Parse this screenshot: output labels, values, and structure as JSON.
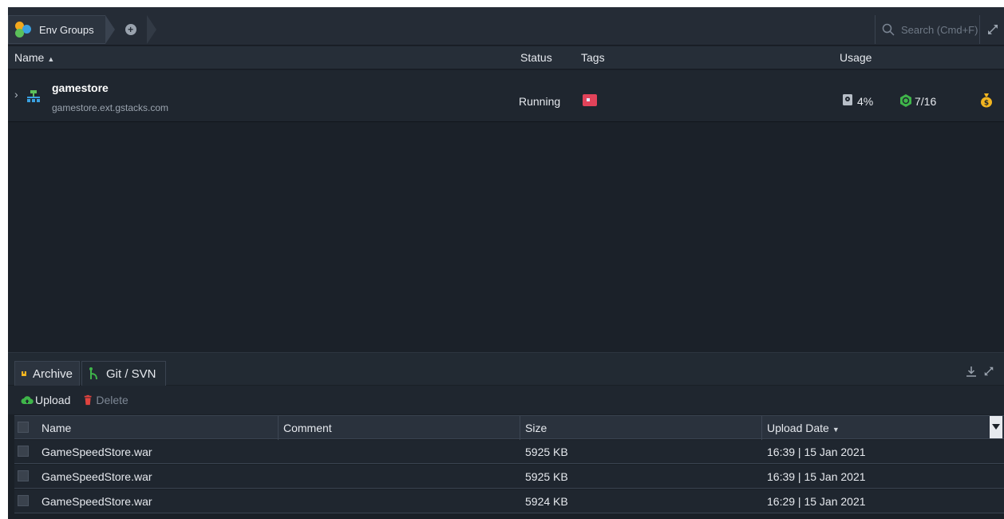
{
  "toolbar": {
    "breadcrumb_label": "Env Groups",
    "search_placeholder": "Search (Cmd+F)"
  },
  "env_header": {
    "name": "Name",
    "status": "Status",
    "tags": "Tags",
    "usage": "Usage"
  },
  "environment": {
    "name": "gamestore",
    "domain": "gamestore.ext.gstacks.com",
    "status": "Running",
    "disk_usage": "4%",
    "cloudlets": "7/16"
  },
  "panel": {
    "tabs": [
      {
        "label": "Archive"
      },
      {
        "label": "Git / SVN"
      }
    ],
    "actions": {
      "upload": "Upload",
      "delete": "Delete"
    },
    "columns": {
      "name": "Name",
      "comment": "Comment",
      "size": "Size",
      "upload_date": "Upload Date"
    },
    "files": [
      {
        "name": "GameSpeedStore.war",
        "comment": "",
        "size": "5925 KB",
        "date": "16:39 | 15 Jan 2021"
      },
      {
        "name": "GameSpeedStore.war",
        "comment": "",
        "size": "5925 KB",
        "date": "16:39 | 15 Jan 2021"
      },
      {
        "name": "GameSpeedStore.war",
        "comment": "",
        "size": "5924 KB",
        "date": "16:29 | 15 Jan 2021"
      }
    ]
  },
  "colors": {
    "background": "#1b2129",
    "accent_green": "#3fb54a",
    "delete_red": "#e0433f",
    "tag_red": "#e2435a",
    "money_gold": "#f2b520"
  },
  "icons": [
    "env-groups-icon",
    "plus-circle-icon",
    "search-icon",
    "expand-icon",
    "chevron-right-icon",
    "environment-topology-icon",
    "flag-tag-icon",
    "disk-icon",
    "cloudlet-icon",
    "money-bag-icon",
    "archive-icon",
    "git-icon",
    "download-icon",
    "upload-cloud-icon",
    "trash-icon"
  ]
}
